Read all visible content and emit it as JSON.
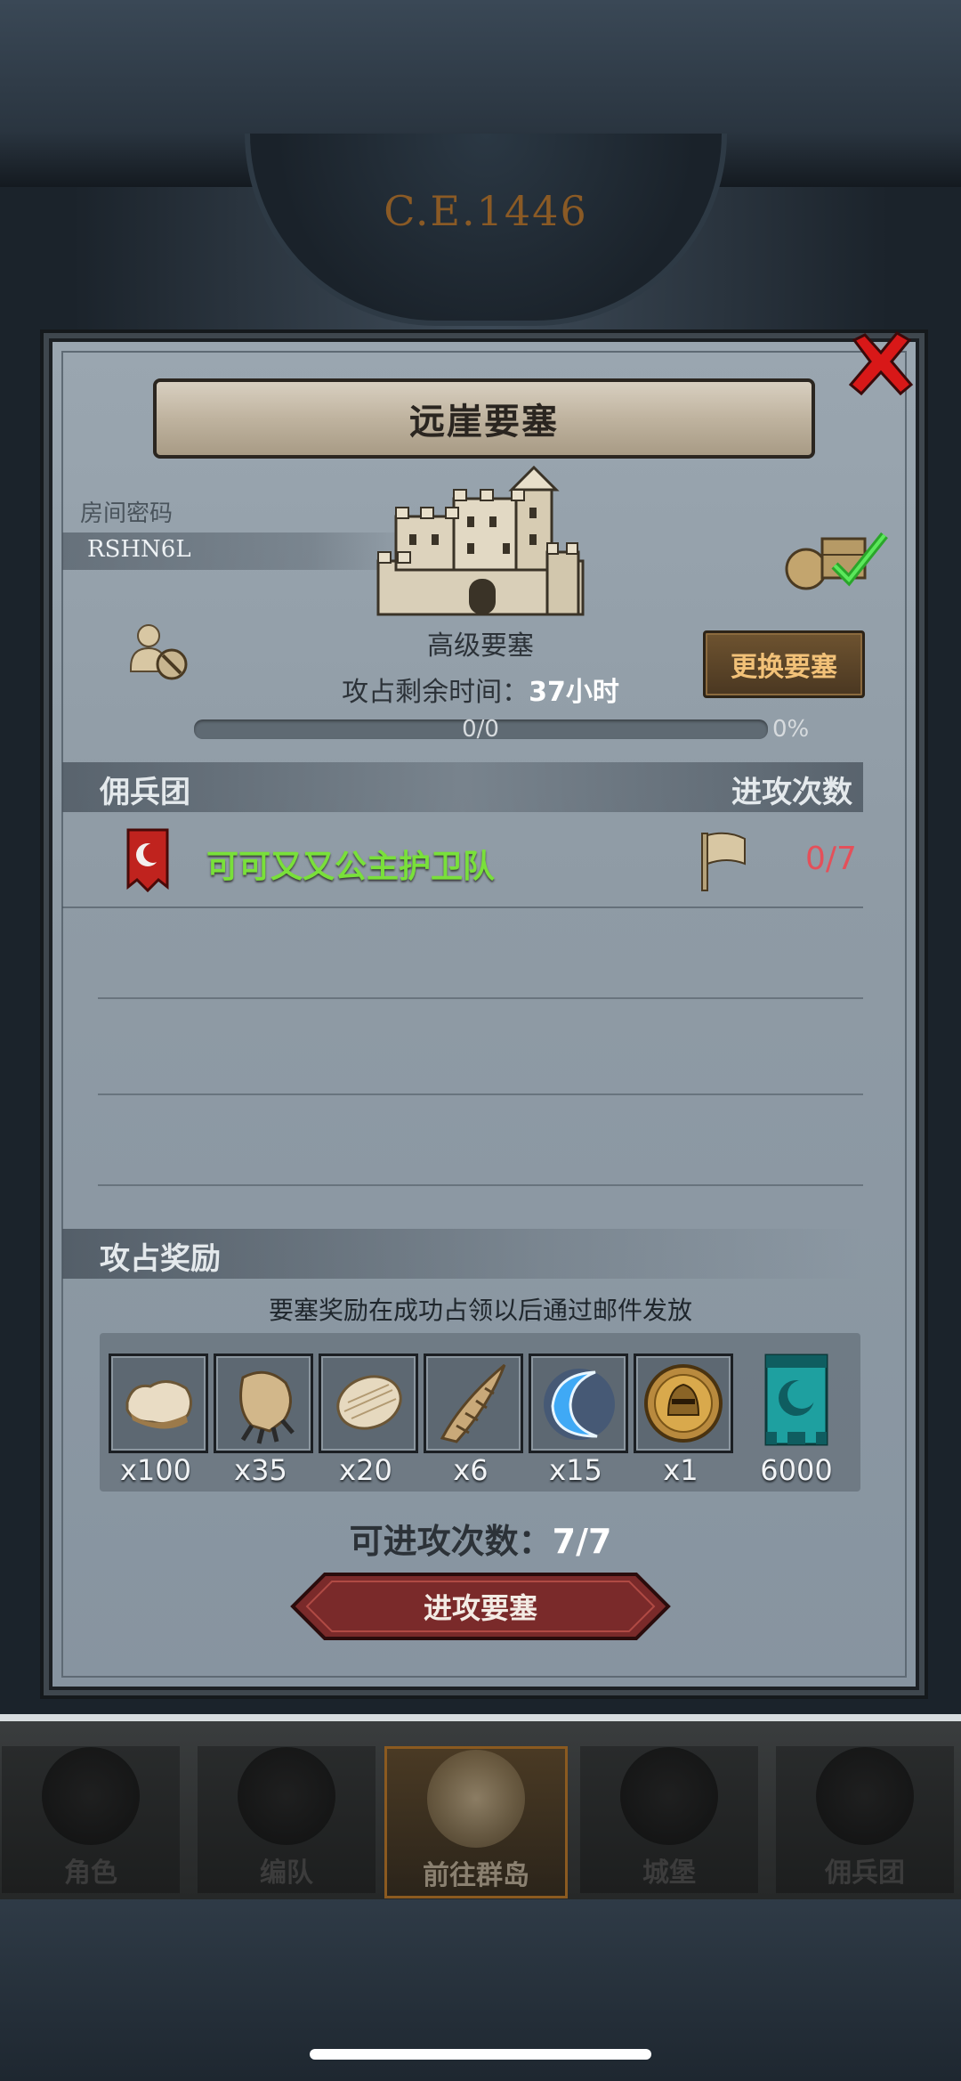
{
  "background": {
    "clock_year": "C.E.1446"
  },
  "panel": {
    "title": "远崖要塞",
    "room": {
      "label": "房间密码",
      "code": "RSHN6L"
    },
    "fortress": {
      "grade": "高级要塞",
      "remain_label": "攻占剩余时间：",
      "remain_value": "37小时"
    },
    "change_button": "更换要塞",
    "progress": {
      "text": "0/0",
      "percent": "0%",
      "fraction": 0
    },
    "mercenary_section": {
      "title": "佣兵团",
      "attacks_header": "进攻次数"
    },
    "mercenaries": [
      {
        "name": "可可又又公主护卫队",
        "attacks": "0/7",
        "banner_color": "#c0231e"
      }
    ],
    "reward_section": {
      "title": "攻占奖励",
      "note": "要塞奖励在成功占领以后通过邮件发放"
    },
    "rewards": [
      {
        "icon": "hide-pelt-icon",
        "qty": "x100"
      },
      {
        "icon": "beast-claw-icon",
        "qty": "x35"
      },
      {
        "icon": "feather-fur-icon",
        "qty": "x20"
      },
      {
        "icon": "horn-icon",
        "qty": "x6"
      },
      {
        "icon": "blue-crescent-icon",
        "qty": "x15"
      },
      {
        "icon": "knight-medal-icon",
        "qty": "x1"
      },
      {
        "icon": "guild-banner-icon",
        "qty": "6000"
      }
    ],
    "attack_remaining": {
      "label": "可进攻次数：",
      "value": "7/7"
    },
    "attack_button": "进攻要塞"
  },
  "nav": {
    "items": [
      {
        "label": "角色",
        "icon": "character-icon",
        "active": false
      },
      {
        "label": "编队",
        "icon": "formation-icon",
        "active": false
      },
      {
        "label": "前往群岛",
        "icon": "compass-icon",
        "active": true
      },
      {
        "label": "城堡",
        "icon": "castle-icon",
        "active": false
      },
      {
        "label": "佣兵团",
        "icon": "mercenary-icon",
        "active": false
      }
    ]
  },
  "colors": {
    "accent_green": "#79e03a",
    "attack_red": "#e4505a",
    "button_gold_text": "#f2c178",
    "close_red": "#d81818"
  }
}
